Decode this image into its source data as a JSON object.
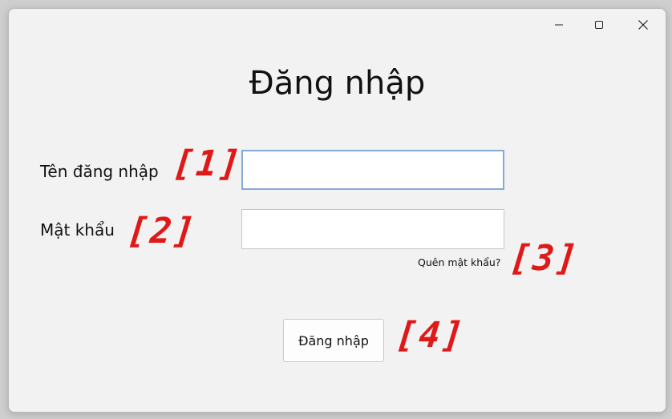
{
  "window": {
    "controls": {
      "minimize_icon": "minimize-icon",
      "maximize_icon": "maximize-icon",
      "close_icon": "close-icon"
    }
  },
  "form": {
    "title": "Đăng nhập",
    "username_label": "Tên đăng nhập",
    "username_value": "",
    "password_label": "Mật khẩu",
    "password_value": "",
    "forgot_password_link": "Quên mật khẩu?",
    "submit_label": "Đăng nhập"
  },
  "annotations": {
    "marker_1": "[1]",
    "marker_2": "[2]",
    "marker_3": "[3]",
    "marker_4": "[4]",
    "color": "#e01818"
  },
  "colors": {
    "window_bg": "#f2f2f2",
    "focus_border": "#86aad9"
  }
}
